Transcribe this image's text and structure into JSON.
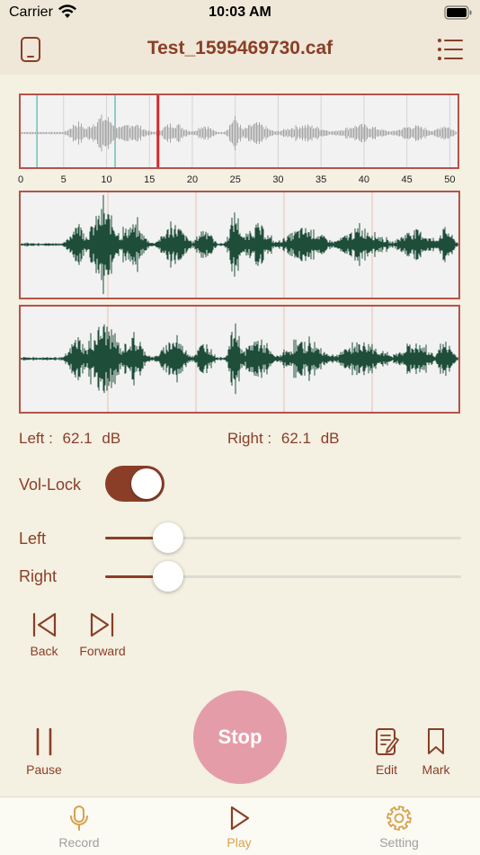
{
  "status_bar": {
    "carrier": "Carrier",
    "time": "10:03 AM"
  },
  "header": {
    "title": "Test_1595469730.caf",
    "left_icon": "phone-device-icon",
    "right_icon": "list-icon"
  },
  "overview": {
    "ticks": [
      "0",
      "5",
      "10",
      "15",
      "20",
      "25",
      "30",
      "35",
      "40",
      "45",
      "50"
    ],
    "playhead_seconds": 16,
    "colors": {
      "border": "#b5534a",
      "playhead": "#d2282e",
      "wave": "#a6a6a6",
      "markers": "#6cc3b7"
    }
  },
  "levels": {
    "left_label": "Left :",
    "left_value": "62.1",
    "right_label": "Right :",
    "right_value": "62.1",
    "unit": "dB"
  },
  "vol_lock": {
    "label": "Vol-Lock",
    "on": true
  },
  "sliders": {
    "left": {
      "label": "Left",
      "value": 0.135
    },
    "right": {
      "label": "Right",
      "value": 0.135
    }
  },
  "transport": {
    "back_label": "Back",
    "forward_label": "Forward"
  },
  "controls": {
    "pause_label": "Pause",
    "stop_label": "Stop",
    "edit_label": "Edit",
    "mark_label": "Mark"
  },
  "tabs": [
    {
      "label": "Record",
      "icon": "microphone-icon",
      "active": false
    },
    {
      "label": "Play",
      "icon": "play-icon",
      "active": true
    },
    {
      "label": "Setting",
      "icon": "gear-icon",
      "active": false
    }
  ],
  "colors": {
    "accent": "#8a3e27",
    "background": "#f4f0e2",
    "stop": "#e49da8",
    "active_tab": "#d7a250",
    "wave_channel": "#1e4d3a"
  }
}
